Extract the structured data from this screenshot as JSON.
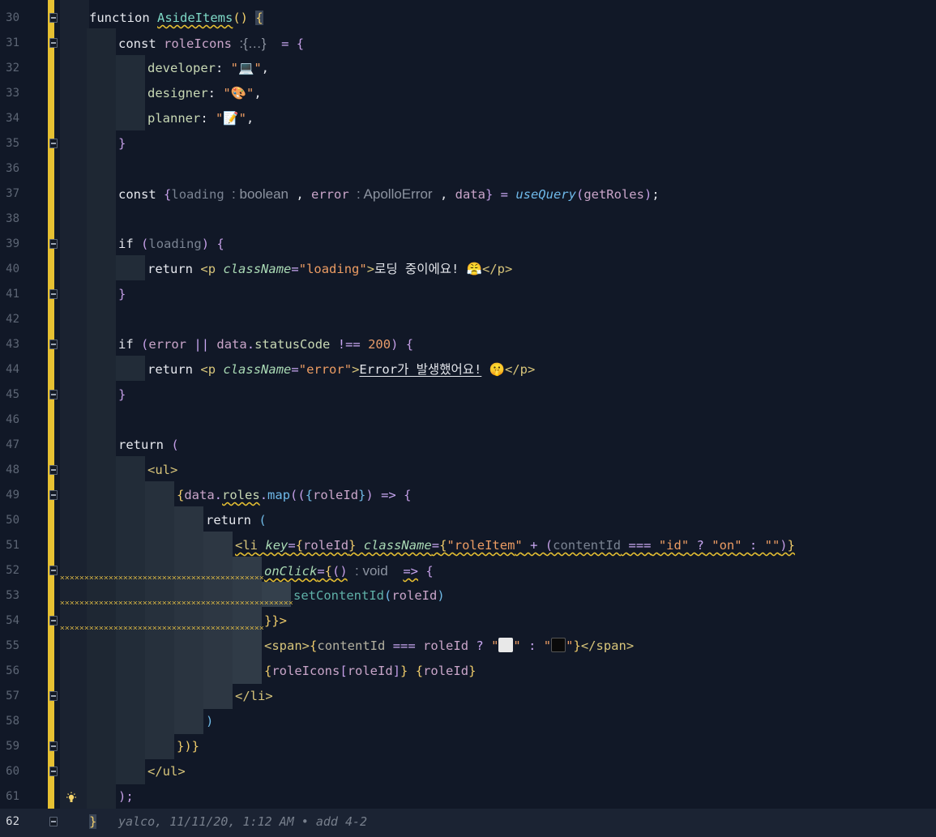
{
  "editor": {
    "lines": [
      {
        "num": "30"
      },
      {
        "num": "31"
      },
      {
        "num": "32"
      },
      {
        "num": "33"
      },
      {
        "num": "34"
      },
      {
        "num": "35"
      },
      {
        "num": "36"
      },
      {
        "num": "37"
      },
      {
        "num": "38"
      },
      {
        "num": "39"
      },
      {
        "num": "40"
      },
      {
        "num": "41"
      },
      {
        "num": "42"
      },
      {
        "num": "43"
      },
      {
        "num": "44"
      },
      {
        "num": "45"
      },
      {
        "num": "46"
      },
      {
        "num": "47"
      },
      {
        "num": "48"
      },
      {
        "num": "49"
      },
      {
        "num": "50"
      },
      {
        "num": "51"
      },
      {
        "num": "52"
      },
      {
        "num": "53"
      },
      {
        "num": "54"
      },
      {
        "num": "55"
      },
      {
        "num": "56"
      },
      {
        "num": "57"
      },
      {
        "num": "58"
      },
      {
        "num": "59"
      },
      {
        "num": "60"
      },
      {
        "num": "61"
      },
      {
        "num": "62"
      }
    ],
    "current_line": "62",
    "blame": "yalco, 11/11/20, 1:12 AM • add 4-2",
    "code": {
      "l30": {
        "kw": "function",
        "name": "AsideItems",
        "rest": "() {"
      },
      "l31": {
        "kw": "const",
        "name": "roleIcons",
        "hint": ":{…}",
        "rest": "= {"
      },
      "l32": {
        "key": "developer",
        "emoji": "💻"
      },
      "l33": {
        "key": "designer",
        "emoji": "🎨"
      },
      "l34": {
        "key": "planner",
        "emoji": "📝"
      },
      "l35": {
        "text": "}"
      },
      "l37": {
        "kw": "const",
        "v1": "loading",
        "t1": "boolean",
        "v2": "error",
        "t2": "ApolloError",
        "v3": "data",
        "fn": "useQuery",
        "arg": "getRoles"
      },
      "l39": {
        "kw": "if",
        "v": "loading"
      },
      "l40": {
        "kw": "return",
        "tag": "p",
        "attr": "className",
        "val": "loading",
        "text": "로딩 중이에요!",
        "emoji": "😤"
      },
      "l41": {
        "text": "}"
      },
      "l43": {
        "kw": "if",
        "v1": "error",
        "v2": "data",
        "prop": "statusCode",
        "num": "200"
      },
      "l44": {
        "kw": "return",
        "tag": "p",
        "attr": "className",
        "val": "error",
        "text": "Error가 발생했어요!",
        "emoji": "🤫"
      },
      "l45": {
        "text": "}"
      },
      "l47": {
        "kw": "return"
      },
      "l48": {
        "tag": "ul"
      },
      "l49": {
        "obj": "data",
        "prop": "roles",
        "fn": "map",
        "arg": "roleId"
      },
      "l50": {
        "kw": "return"
      },
      "l51": {
        "tag": "li",
        "attr1": "key",
        "v1": "roleId",
        "attr2": "className",
        "s1": "roleItem",
        "v2": "contentId",
        "s2": "id",
        "s3": "on"
      },
      "l52": {
        "attr": "onClick",
        "hint": ": void"
      },
      "l53": {
        "fn": "setContentId",
        "arg": "roleId"
      },
      "l54": {
        "text": "}}>"
      },
      "l55": {
        "tag": "span",
        "v1": "contentId",
        "v2": "roleId"
      },
      "l56": {
        "obj": "roleIcons",
        "v": "roleId"
      },
      "l57": {
        "tag": "li"
      },
      "l58": {
        "text": ")"
      },
      "l59": {
        "text": "})}"
      },
      "l60": {
        "tag": "ul"
      },
      "l61": {
        "text": ");"
      },
      "l62": {
        "text": "}"
      }
    }
  }
}
